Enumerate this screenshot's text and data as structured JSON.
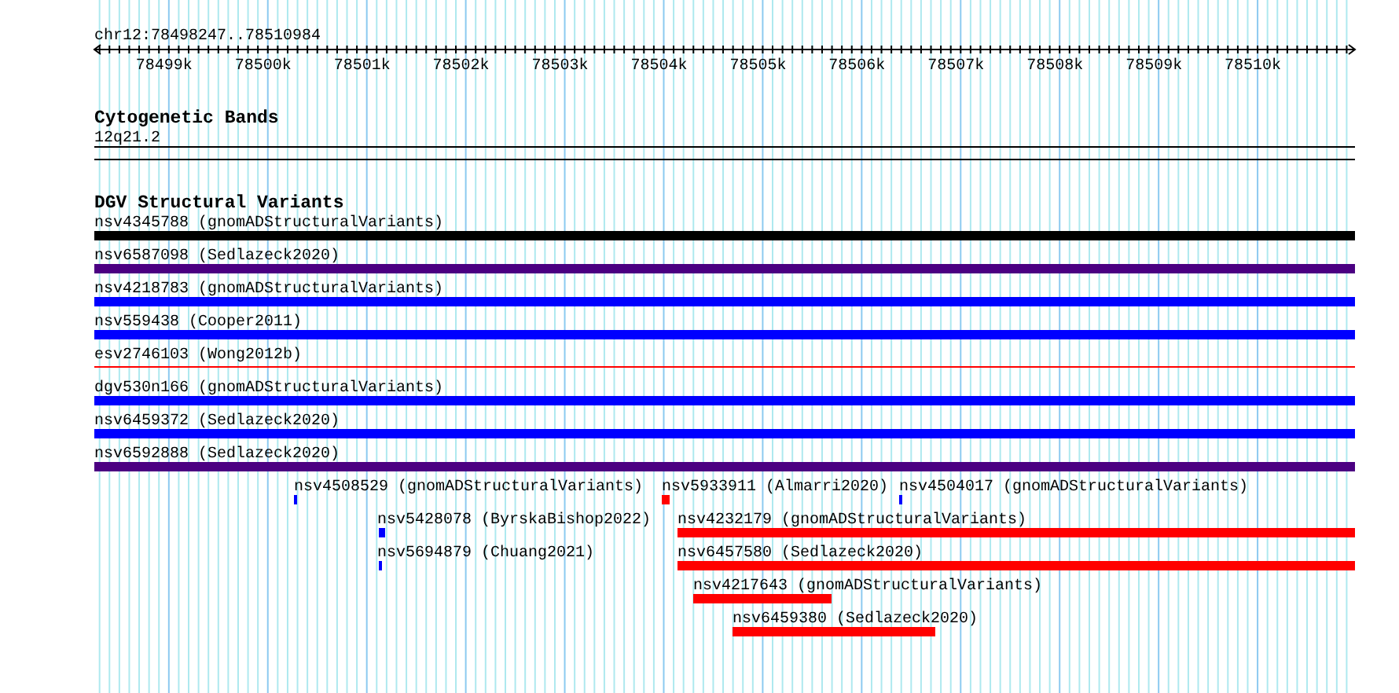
{
  "ruler": {
    "region": "chr12:78498247..78510984",
    "ticks": [
      "78499k",
      "78500k",
      "78501k",
      "78502k",
      "78503k",
      "78504k",
      "78505k",
      "78506k",
      "78507k",
      "78508k",
      "78509k",
      "78510k"
    ]
  },
  "tracks": [
    {
      "title": "Cytogenetic Bands",
      "features": [
        {
          "label": "12q21.2",
          "kind": "band"
        }
      ]
    },
    {
      "title": "DGV Structural Variants",
      "features": [
        {
          "label": "nsv4345788 (gnomADStructuralVariants)",
          "color": "#000000",
          "kind": "bar"
        },
        {
          "label": "nsv6587098 (Sedlazeck2020)",
          "color": "#4b0082",
          "kind": "bar"
        },
        {
          "label": "nsv4218783 (gnomADStructuralVariants)",
          "color": "#0000ff",
          "kind": "bar"
        },
        {
          "label": "nsv559438 (Cooper2011)",
          "color": "#0000ff",
          "kind": "bar"
        },
        {
          "label": "esv2746103 (Wong2012b)",
          "color": "#ff0000",
          "kind": "line"
        },
        {
          "label": "dgv530n166 (gnomADStructuralVariants)",
          "color": "#0000ff",
          "kind": "bar"
        },
        {
          "label": "nsv6459372 (Sedlazeck2020)",
          "color": "#0000ff",
          "kind": "bar"
        },
        {
          "label": "nsv6592888 (Sedlazeck2020)",
          "color": "#4b0082",
          "kind": "bar"
        },
        {
          "label": "nsv4508529 (gnomADStructuralVariants)",
          "color": "#0000ff",
          "kind": "bar"
        },
        {
          "label": "nsv5933911 (Almarri2020)",
          "color": "#ff0000",
          "kind": "bar"
        },
        {
          "label": "nsv4504017 (gnomADStructuralVariants)",
          "color": "#0000ff",
          "kind": "bar"
        },
        {
          "label": "nsv5428078 (ByrskaBishop2022)",
          "color": "#0000ff",
          "kind": "bar"
        },
        {
          "label": "nsv4232179 (gnomADStructuralVariants)",
          "color": "#ff0000",
          "kind": "bar"
        },
        {
          "label": "nsv5694879 (Chuang2021)",
          "color": "#0000ff",
          "kind": "bar"
        },
        {
          "label": "nsv6457580 (Sedlazeck2020)",
          "color": "#ff0000",
          "kind": "bar"
        },
        {
          "label": "nsv4217643 (gnomADStructuralVariants)",
          "color": "#ff0000",
          "kind": "bar"
        },
        {
          "label": "nsv6459380 (Sedlazeck2020)",
          "color": "#ff0000",
          "kind": "bar"
        }
      ]
    }
  ]
}
